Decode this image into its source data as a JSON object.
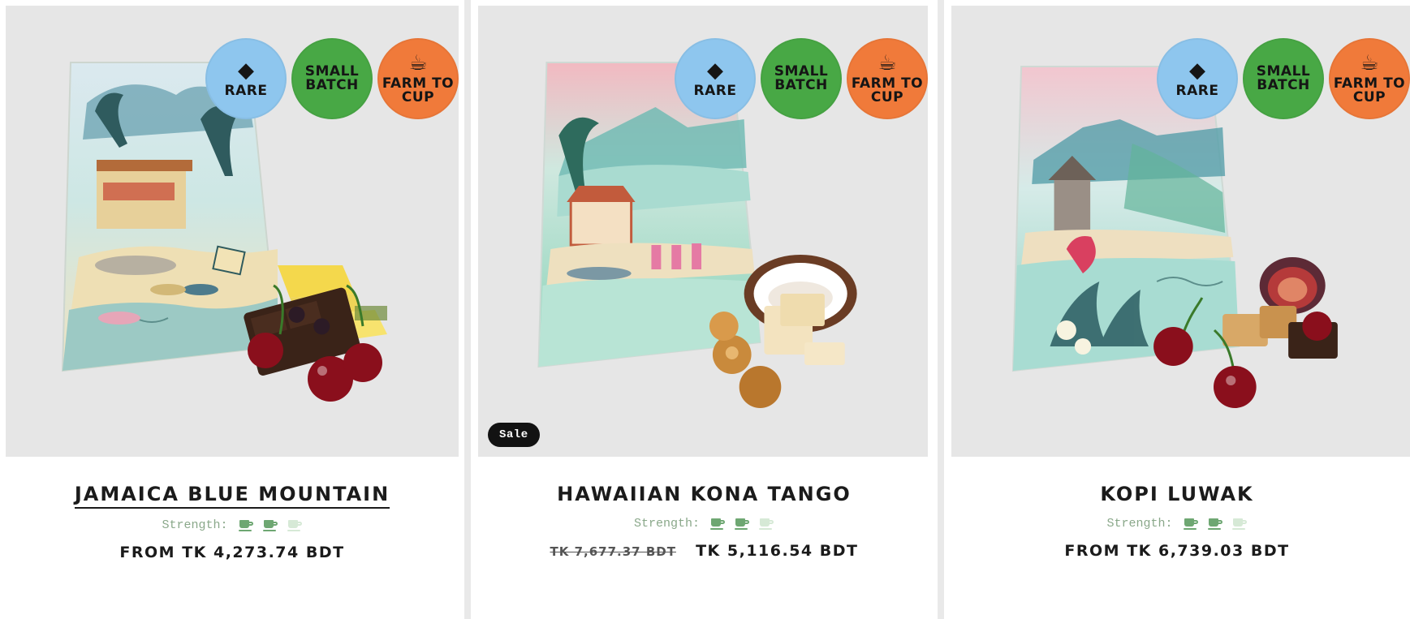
{
  "products": [
    {
      "name": "JAMAICA BLUE MOUNTAIN",
      "strength_label": "Strength:",
      "strength_level": 2,
      "strength_max": 3,
      "price": "FROM TK 4,273.74 BDT",
      "old_price": "",
      "badges": {
        "rare": "RARE",
        "small_batch": "SMALL\nBATCH",
        "farm_to_cup": "FARM TO\nCUP"
      },
      "illustration": {
        "bag": [
          "#f3e8c6",
          "#7fb8b2",
          "#e7d09a"
        ],
        "sky": "#c9e5ec",
        "sand": "#eedfb4",
        "sea": "#9cc9c4",
        "accent": "#2f5b5e"
      },
      "garnish": "pineapple-chocolate-cherries"
    },
    {
      "name": "HAWAIIAN KONA TANGO",
      "strength_label": "Strength:",
      "strength_level": 2,
      "strength_max": 3,
      "price": "TK 5,116.54 BDT",
      "old_price": "TK 7,677.37 BDT",
      "sale_label": "Sale",
      "badges": {
        "rare": "RARE",
        "small_batch": "SMALL\nBATCH",
        "farm_to_cup": "FARM TO\nCUP"
      },
      "illustration": {
        "bag": [
          "#f2b9c1",
          "#9bd6c8",
          "#6cc4a3"
        ],
        "sky": "#a9dbd0",
        "sand": "#eee0bf",
        "sea": "#b8e4d5",
        "accent": "#2e6b5d"
      },
      "garnish": "coconut-caramel-white-chocolate"
    },
    {
      "name": "KOPI LUWAK",
      "strength_label": "Strength:",
      "strength_level": 2,
      "strength_max": 3,
      "price": "FROM TK 6,739.03 BDT",
      "old_price": "",
      "badges": {
        "rare": "RARE",
        "small_batch": "SMALL\nBATCH",
        "farm_to_cup": "FARM TO\nCUP"
      },
      "illustration": {
        "bag": [
          "#f2c6cf",
          "#9fd3cf",
          "#79c6b1"
        ],
        "sky": "#bfe2e2",
        "sand": "#eedfc0",
        "sea": "#a8dcd2",
        "accent": "#2b5d62"
      },
      "garnish": "fig-cherries-fudge"
    }
  ],
  "icons": {
    "rare": "diamond-icon",
    "small_batch": "batch-icon",
    "farm_to_cup": "leaf-cup-icon",
    "strength": "coffee-cup-icon"
  },
  "colors": {
    "rare_badge": "#8ec6ee",
    "small_batch_badge": "#48a845",
    "farm_to_cup_badge": "#f07a3a",
    "strength_text": "#8aa88a",
    "strength_cup_active": "#6ea772",
    "strength_cup_inactive": "#d6e9d6",
    "sale_pill": "#121212"
  }
}
